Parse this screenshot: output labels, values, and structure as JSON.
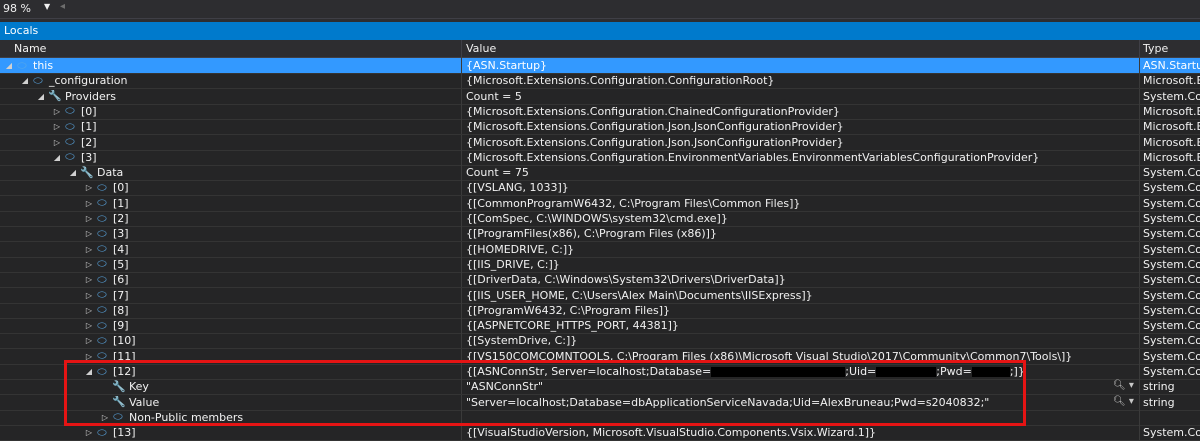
{
  "toolbar": {
    "zoom": "98 %"
  },
  "window_title": "Locals",
  "columns": {
    "name": "Name",
    "value": "Value",
    "type": "Type"
  },
  "rows": [
    {
      "indent": 0,
      "expander": "open",
      "icon": "object-icon",
      "name": "this",
      "value": "{ASN.Startup}",
      "type": "ASN.Startup",
      "selected": true
    },
    {
      "indent": 1,
      "expander": "open",
      "icon": "private-field-icon",
      "name": "_configuration",
      "value": "{Microsoft.Extensions.Configuration.ConfigurationRoot}",
      "type": "Microsoft.Ex"
    },
    {
      "indent": 2,
      "expander": "open",
      "icon": "wrench-icon",
      "name": "Providers",
      "value": "Count = 5",
      "type": "System.Coll"
    },
    {
      "indent": 3,
      "expander": "closed",
      "icon": "object-icon",
      "name": "[0]",
      "value": "{Microsoft.Extensions.Configuration.ChainedConfigurationProvider}",
      "type": "Microsoft.Ex"
    },
    {
      "indent": 3,
      "expander": "closed",
      "icon": "object-icon",
      "name": "[1]",
      "value": "{Microsoft.Extensions.Configuration.Json.JsonConfigurationProvider}",
      "type": "Microsoft.Ex"
    },
    {
      "indent": 3,
      "expander": "closed",
      "icon": "object-icon",
      "name": "[2]",
      "value": "{Microsoft.Extensions.Configuration.Json.JsonConfigurationProvider}",
      "type": "Microsoft.Ex"
    },
    {
      "indent": 3,
      "expander": "open",
      "icon": "object-icon",
      "name": "[3]",
      "value": "{Microsoft.Extensions.Configuration.EnvironmentVariables.EnvironmentVariablesConfigurationProvider}",
      "type": "Microsoft.Ex"
    },
    {
      "indent": 4,
      "expander": "open",
      "icon": "protected-property-icon",
      "name": "Data",
      "value": "Count = 75",
      "type": "System.Coll"
    },
    {
      "indent": 5,
      "expander": "closed",
      "icon": "object-icon",
      "name": "[0]",
      "value": "{[VSLANG, 1033]}",
      "type": "System.Coll"
    },
    {
      "indent": 5,
      "expander": "closed",
      "icon": "object-icon",
      "name": "[1]",
      "value": "{[CommonProgramW6432, C:\\Program Files\\Common Files]}",
      "type": "System.Coll"
    },
    {
      "indent": 5,
      "expander": "closed",
      "icon": "object-icon",
      "name": "[2]",
      "value": "{[ComSpec, C:\\WINDOWS\\system32\\cmd.exe]}",
      "type": "System.Coll"
    },
    {
      "indent": 5,
      "expander": "closed",
      "icon": "object-icon",
      "name": "[3]",
      "value": "{[ProgramFiles(x86), C:\\Program Files (x86)]}",
      "type": "System.Coll"
    },
    {
      "indent": 5,
      "expander": "closed",
      "icon": "object-icon",
      "name": "[4]",
      "value": "{[HOMEDRIVE, C:]}",
      "type": "System.Coll"
    },
    {
      "indent": 5,
      "expander": "closed",
      "icon": "object-icon",
      "name": "[5]",
      "value": "{[IIS_DRIVE, C:]}",
      "type": "System.Coll"
    },
    {
      "indent": 5,
      "expander": "closed",
      "icon": "object-icon",
      "name": "[6]",
      "value": "{[DriverData, C:\\Windows\\System32\\Drivers\\DriverData]}",
      "type": "System.Coll"
    },
    {
      "indent": 5,
      "expander": "closed",
      "icon": "object-icon",
      "name": "[7]",
      "value": "{[IIS_USER_HOME, C:\\Users\\Alex Main\\Documents\\IISExpress]}",
      "type": "System.Coll"
    },
    {
      "indent": 5,
      "expander": "closed",
      "icon": "object-icon",
      "name": "[8]",
      "value": "{[ProgramW6432, C:\\Program Files]}",
      "type": "System.Coll"
    },
    {
      "indent": 5,
      "expander": "closed",
      "icon": "object-icon",
      "name": "[9]",
      "value": "{[ASPNETCORE_HTTPS_PORT, 44381]}",
      "type": "System.Coll"
    },
    {
      "indent": 5,
      "expander": "closed",
      "icon": "object-icon",
      "name": "[10]",
      "value": "{[SystemDrive, C:]}",
      "type": "System.Coll"
    },
    {
      "indent": 5,
      "expander": "closed",
      "icon": "object-icon",
      "name": "[11]",
      "value": "{[VS150COMCOMNTOOLS, C:\\Program Files (x86)\\Microsoft Visual Studio\\2017\\Community\\Common7\\Tools\\]}",
      "type": "System.Coll"
    },
    {
      "indent": 5,
      "expander": "open",
      "icon": "object-icon",
      "name": "[12]",
      "value_parts": [
        "{[ASNConnStr, Server=localhost;Database=",
        "",
        ";Uid=",
        "",
        ";Pwd=",
        "",
        ";]}"
      ],
      "type": "System.Coll"
    },
    {
      "indent": 6,
      "expander": "none",
      "icon": "wrench-icon",
      "name": "Key",
      "value": "\"ASNConnStr\"",
      "type": "string",
      "magnifier": true
    },
    {
      "indent": 6,
      "expander": "none",
      "icon": "wrench-icon",
      "name": "Value",
      "value": "\"Server=localhost;Database=dbApplicationServiceNavada;Uid=AlexBruneau;Pwd=s2040832;\"",
      "type": "string",
      "magnifier": true
    },
    {
      "indent": 6,
      "expander": "closed",
      "icon": "object-icon",
      "name": "Non-Public members",
      "value": "",
      "type": ""
    },
    {
      "indent": 5,
      "expander": "closed",
      "icon": "object-icon",
      "name": "[13]",
      "value": "{[VisualStudioVersion, Microsoft.VisualStudio.Components.Vsix.Wizard.1]}",
      "type": "System.Coll"
    }
  ],
  "colors": {
    "accent": "#007acc",
    "selection": "#3399ff",
    "highlight_box": "#e51414",
    "background": "#252526"
  }
}
